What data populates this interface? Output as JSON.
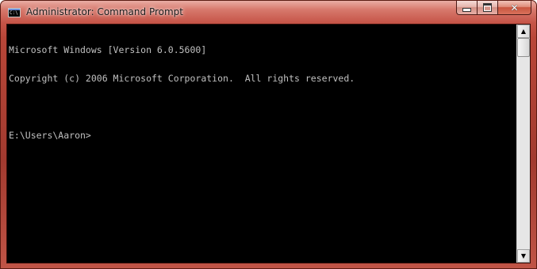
{
  "window": {
    "title": "Administrator: Command Prompt",
    "icon": "cmd-icon",
    "icon_text": "C:\\"
  },
  "caption_buttons": {
    "minimize": "minimize-icon",
    "maximize": "maximize-icon",
    "close": "close-icon"
  },
  "console": {
    "lines": [
      "Microsoft Windows [Version 6.0.5600]",
      "Copyright (c) 2006 Microsoft Corporation.  All rights reserved.",
      "",
      "E:\\Users\\Aaron>"
    ],
    "foreground": "#c0c0c0",
    "background": "#000000"
  },
  "scrollbar": {
    "up_icon": "scroll-up-arrow-icon",
    "down_icon": "scroll-down-arrow-icon"
  }
}
